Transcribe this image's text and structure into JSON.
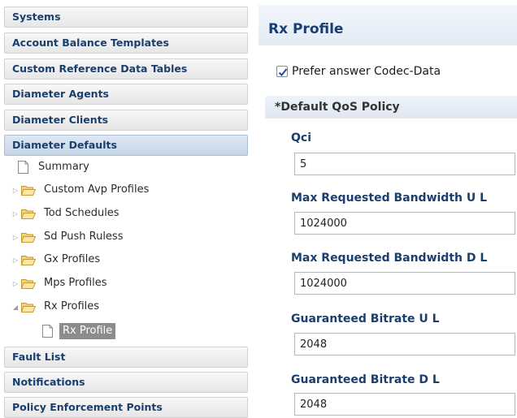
{
  "nav": {
    "headers_top": [
      {
        "label": "Systems"
      },
      {
        "label": "Account Balance Templates"
      },
      {
        "label": "Custom Reference Data Tables"
      },
      {
        "label": "Diameter Agents"
      },
      {
        "label": "Diameter Clients"
      },
      {
        "label": "Diameter Defaults"
      }
    ],
    "tree": {
      "summary": "Summary",
      "custom_avp": "Custom Avp Profiles",
      "tod": "Tod Schedules",
      "sd_push": "Sd Push Ruless",
      "gx": "Gx Profiles",
      "mps": "Mps Profiles",
      "rx": "Rx Profiles",
      "rx_profile": "Rx Profile"
    },
    "headers_bottom": [
      {
        "label": "Fault List"
      },
      {
        "label": "Notifications"
      },
      {
        "label": "Policy Enforcement Points"
      }
    ]
  },
  "main": {
    "title": "Rx Profile",
    "prefer_codec": {
      "label": "Prefer answer Codec-Data",
      "checked": true
    },
    "section_title": "*Default QoS Policy",
    "fields": [
      {
        "label": "Qci",
        "value": "5"
      },
      {
        "label": "Max Requested Bandwidth U L",
        "value": "1024000"
      },
      {
        "label": "Max Requested Bandwidth D L",
        "value": "1024000"
      },
      {
        "label": "Guaranteed Bitrate U L",
        "value": "2048"
      },
      {
        "label": "Guaranteed Bitrate D L",
        "value": "2048"
      }
    ]
  },
  "colors": {
    "header_text": "#1a3f6f",
    "selected_bg": "#8c8c8c",
    "folder": "#e8b84a"
  }
}
